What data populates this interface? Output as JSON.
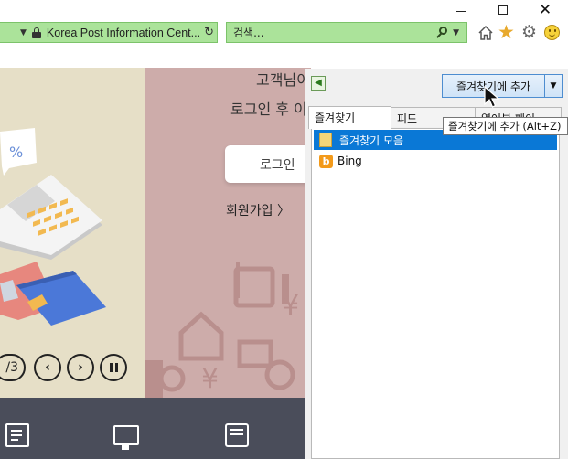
{
  "browser": {
    "site_name": "Korea Post Information Cent...",
    "search_placeholder": "검색...",
    "refresh_glyph": "↻",
    "dropdown_glyph": "▼",
    "close_glyph": "✕",
    "star_glyph": "★",
    "gear_glyph": "⚙"
  },
  "page": {
    "greeting_line1": "고객님이",
    "greeting_line2": "로그인 후 이",
    "login_label": "로그인",
    "signup_label": "회원가입 〉",
    "slide_counter": "/3",
    "prev_glyph": "‹",
    "next_glyph": "›",
    "colors": {
      "banner_bg": "#e6dfc7",
      "panel_pink": "#cdacaa",
      "footer_bg": "#4a4d5a"
    }
  },
  "favorites_panel": {
    "add_button_label": "즐겨찾기에 추가",
    "dropdown_glyph": "▼",
    "pin_glyph": "◀",
    "tabs": [
      {
        "label": "즐겨찾기",
        "active": true
      },
      {
        "label": "피드",
        "active": false
      },
      {
        "label": "열어본 페이",
        "active": false
      }
    ],
    "items": [
      {
        "label": "즐겨찾기 모음",
        "icon": "folder-icon",
        "selected": true
      },
      {
        "label": "Bing",
        "icon": "bing-icon",
        "selected": false
      }
    ],
    "bing_glyph": "b",
    "tooltip": "즐겨찾기에 추가 (Alt+Z)",
    "colors": {
      "selection": "#0a78d6",
      "address_bar": "#abe39a"
    }
  }
}
